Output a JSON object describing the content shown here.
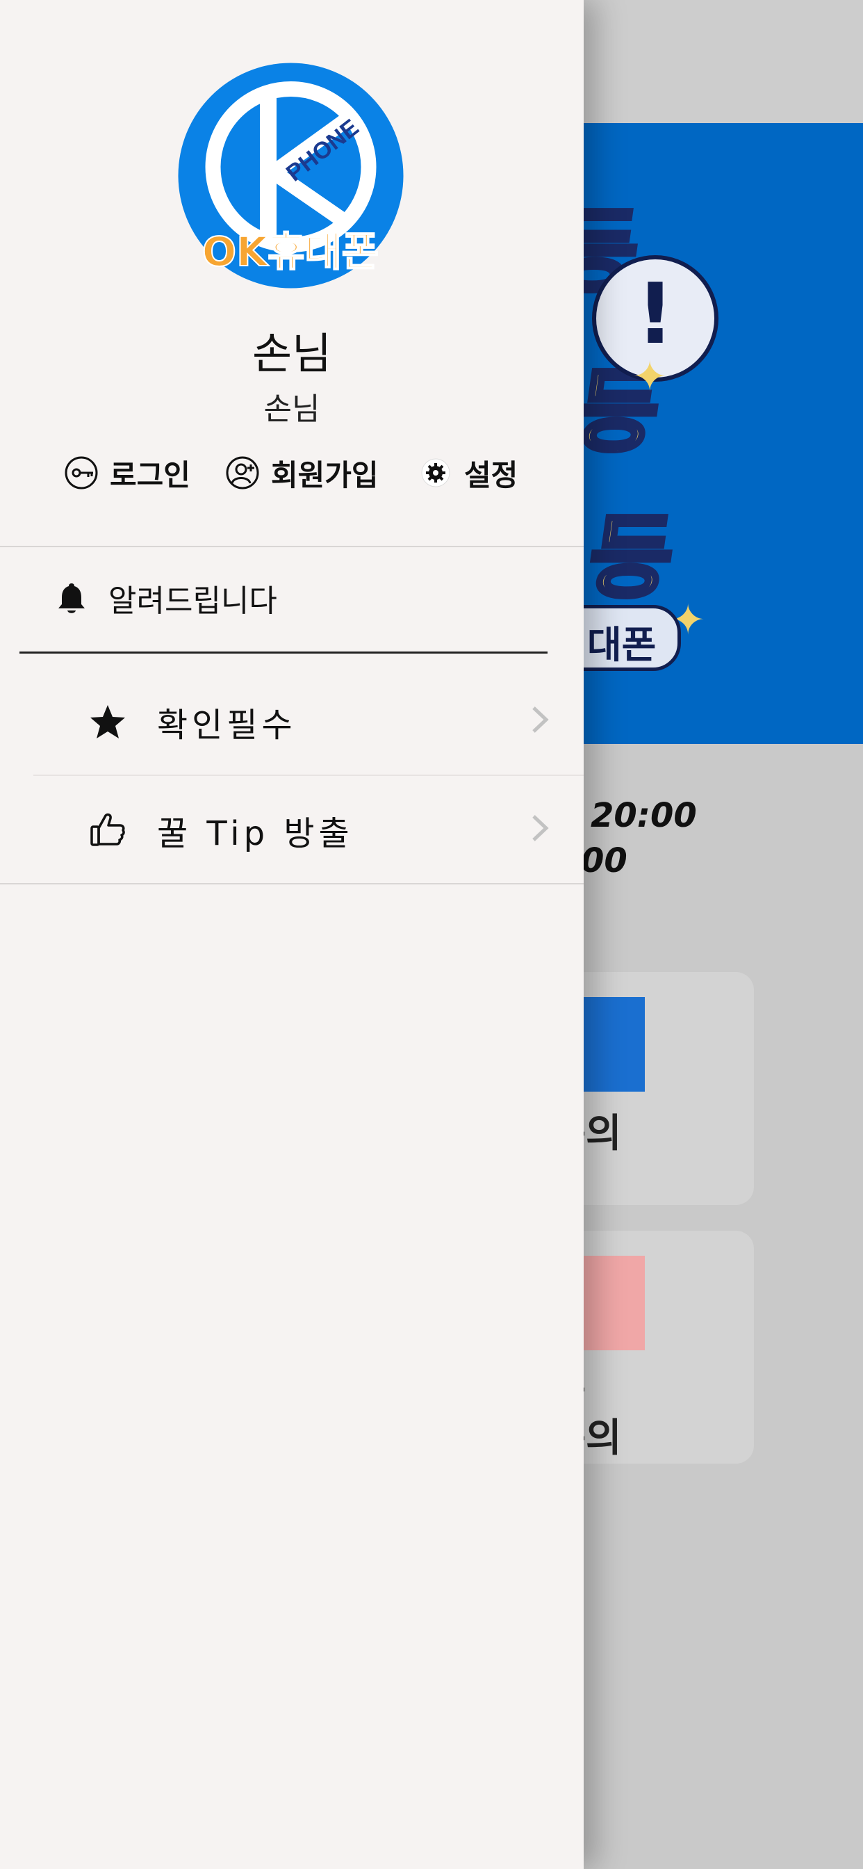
{
  "background": {
    "hours_line1": "20:00",
    "hours_line2": "00",
    "card1_label": "뜸문의",
    "card2_label_line1": "쇄몰",
    "card2_label_line2": "뜸문의",
    "banner_pill": "대폰"
  },
  "drawer": {
    "logo": {
      "top_text": "PHONE",
      "bottom_text": "OK휴대폰"
    },
    "profile": {
      "name": "손님",
      "subtitle": "손님"
    },
    "actions": [
      {
        "label": "로그인",
        "icon": "login-key-icon"
      },
      {
        "label": "회원가입",
        "icon": "signup-user-icon"
      },
      {
        "label": "설정",
        "icon": "settings-gear-icon"
      }
    ],
    "notice": {
      "label": "알려드립니다",
      "icon": "bell-icon"
    },
    "menu": [
      {
        "label": "확인필수",
        "icon": "star-icon"
      },
      {
        "label": "꿀 Tip 방출",
        "icon": "thumbs-up-icon"
      }
    ]
  },
  "colors": {
    "drawer_bg": "#f6f3f2",
    "brand_blue": "#0067c3",
    "logo_orange": "#f7a531"
  }
}
